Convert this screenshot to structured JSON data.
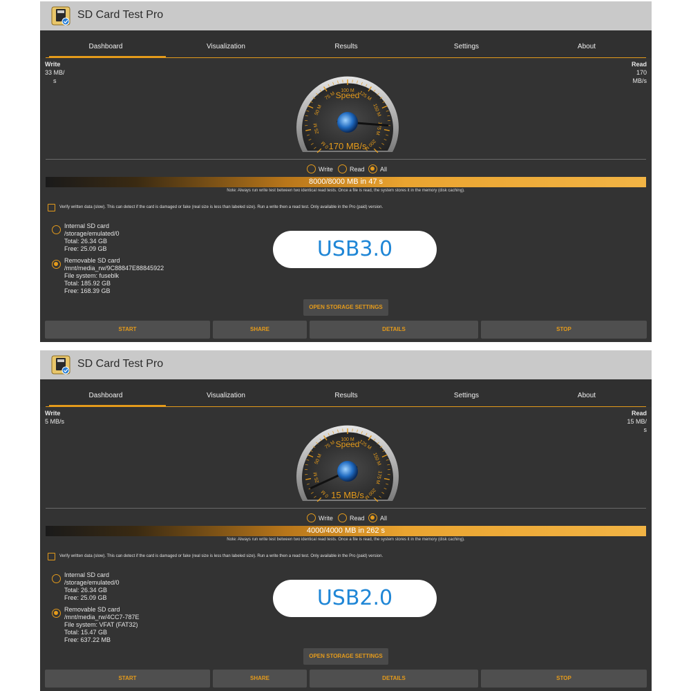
{
  "app": {
    "title": "SD Card Test Pro",
    "accent_color": "#e59b1b",
    "icon": "sd-card-icon"
  },
  "tabs": [
    "Dashboard",
    "Visualization",
    "Results",
    "Settings",
    "About"
  ],
  "gauge_ticks": [
    "0 M",
    "25 M",
    "50 M",
    "75 M",
    "100 M",
    "125 M",
    "150 M",
    "175 M",
    "200 M"
  ],
  "gauge_title": "Speed",
  "mode_options": [
    "Write",
    "Read",
    "All"
  ],
  "note": "Note: Always run write test between two identical read tests. Once a file is read, the system stores it in the memory (disk caching).",
  "verify_text": "Verify written data (slow). This can detect if the card is damaged or fake (real size is less than labeled size). Run a write then a read test. Only available in the Pro (paid) version.",
  "open_storage_label": "OPEN STORAGE SETTINGS",
  "buttons": [
    "START",
    "SHARE",
    "DETAILS",
    "STOP"
  ],
  "panels": [
    {
      "write_label": "Write",
      "write_value": "33 MB/",
      "write_unit": "s",
      "read_label": "Read",
      "read_value": "170",
      "read_unit": "MB/s",
      "gauge_value": "170 MB/s",
      "gauge_speed_mbps": 170,
      "selected_mode": "All",
      "progress_text": "8000/8000 MB in 47 s",
      "progress_fraction": 1.0,
      "internal": {
        "title": "Internal SD card",
        "path": "/storage/emulated/0",
        "total": "Total: 26.34 GB",
        "free": "Free: 25.09 GB",
        "selected": false
      },
      "removable": {
        "title": "Removable SD card",
        "path": "/mnt/media_rw/9C88847E88845922",
        "fs": "File system: fuseblk",
        "total": "Total: 185.92 GB",
        "free": "Free: 168.39 GB",
        "selected": true
      },
      "badge": "USB3.0"
    },
    {
      "write_label": "Write",
      "write_value": "5 MB/s",
      "write_unit": "",
      "read_label": "Read",
      "read_value": "15 MB/",
      "read_unit": "s",
      "gauge_value": "15 MB/s",
      "gauge_speed_mbps": 15,
      "selected_mode": "All",
      "progress_text": "4000/4000 MB in 262 s",
      "progress_fraction": 1.0,
      "internal": {
        "title": "Internal SD card",
        "path": "/storage/emulated/0",
        "total": "Total: 26.34 GB",
        "free": "Free: 25.09 GB",
        "selected": false
      },
      "removable": {
        "title": "Removable SD card",
        "path": "/mnt/media_rw/4CC7-787E",
        "fs": "File system: VFAT (FAT32)",
        "total": "Total: 15.47 GB",
        "free": "Free: 637.22 MB",
        "selected": true
      },
      "badge": "USB2.0"
    }
  ]
}
